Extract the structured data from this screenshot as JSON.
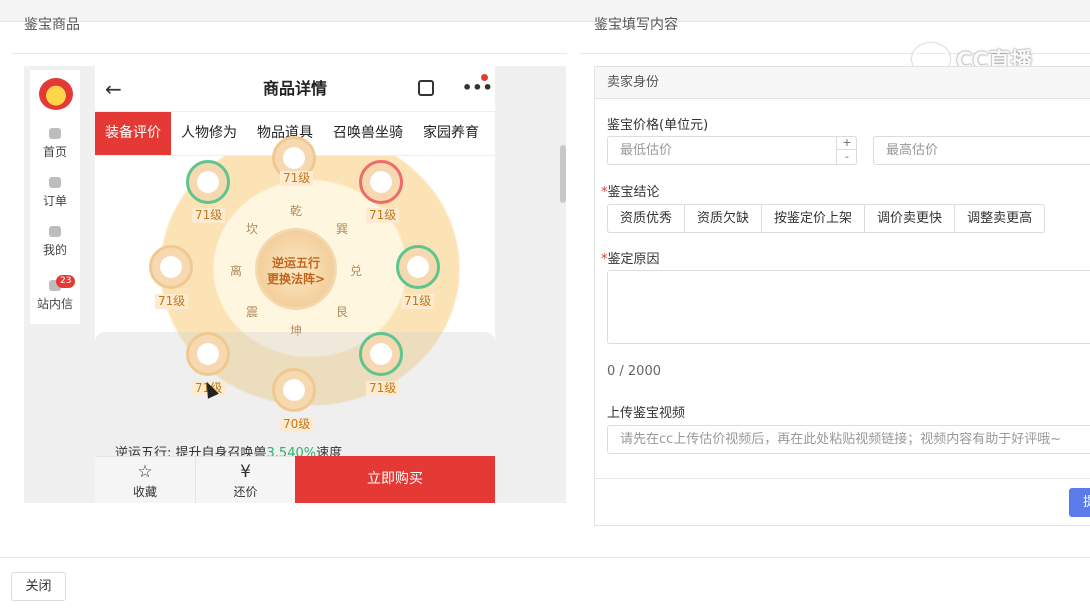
{
  "header": {
    "left_title": "鉴宝商品",
    "right_title": "鉴宝填写内容"
  },
  "watermark": {
    "text": "CC直播"
  },
  "preview": {
    "nav": [
      {
        "label": "首页",
        "icon": "home-icon"
      },
      {
        "label": "订单",
        "icon": "order-icon"
      },
      {
        "label": "我的",
        "icon": "user-icon"
      },
      {
        "label": "站内信",
        "icon": "mail-icon"
      }
    ],
    "mail_badge": "23",
    "page_title": "商品详情",
    "tabs": [
      "装备评价",
      "人物修为",
      "物品道具",
      "召唤兽坐骑",
      "家园养育"
    ],
    "center_line1": "逆运五行",
    "center_line2": "更换法阵>",
    "levels": [
      "71级",
      "71级",
      "71级",
      "71级",
      "71级",
      "71级",
      "71级",
      "70级"
    ],
    "trigrams": [
      "乾",
      "巽",
      "坎",
      "艮",
      "坤",
      "震",
      "离",
      "兑"
    ],
    "desc_prefix": "逆运五行: 提升自身召唤兽",
    "desc_highlight": "3.540%",
    "desc_suffix": "速度",
    "fav_label": "收藏",
    "bargain_label": "还价",
    "buy_label": "立即购买"
  },
  "form": {
    "section_title": "卖家身份",
    "price_label": "鉴宝价格(单位元)",
    "min_placeholder": "最低估价",
    "max_placeholder": "最高估价",
    "conclusion_label": "鉴宝结论",
    "conclusion_options": [
      "资质优秀",
      "资质欠缺",
      "按鉴定价上架",
      "调价卖更快",
      "调整卖更高"
    ],
    "reason_label": "鉴定原因",
    "char_count": "0 / 2000",
    "video_label": "上传鉴宝视频",
    "video_placeholder": "请先在cc上传估价视频后，再在此处粘贴视频链接；视频内容有助于好评哦~",
    "submit_label": "提"
  },
  "footer": {
    "close_label": "关闭"
  }
}
